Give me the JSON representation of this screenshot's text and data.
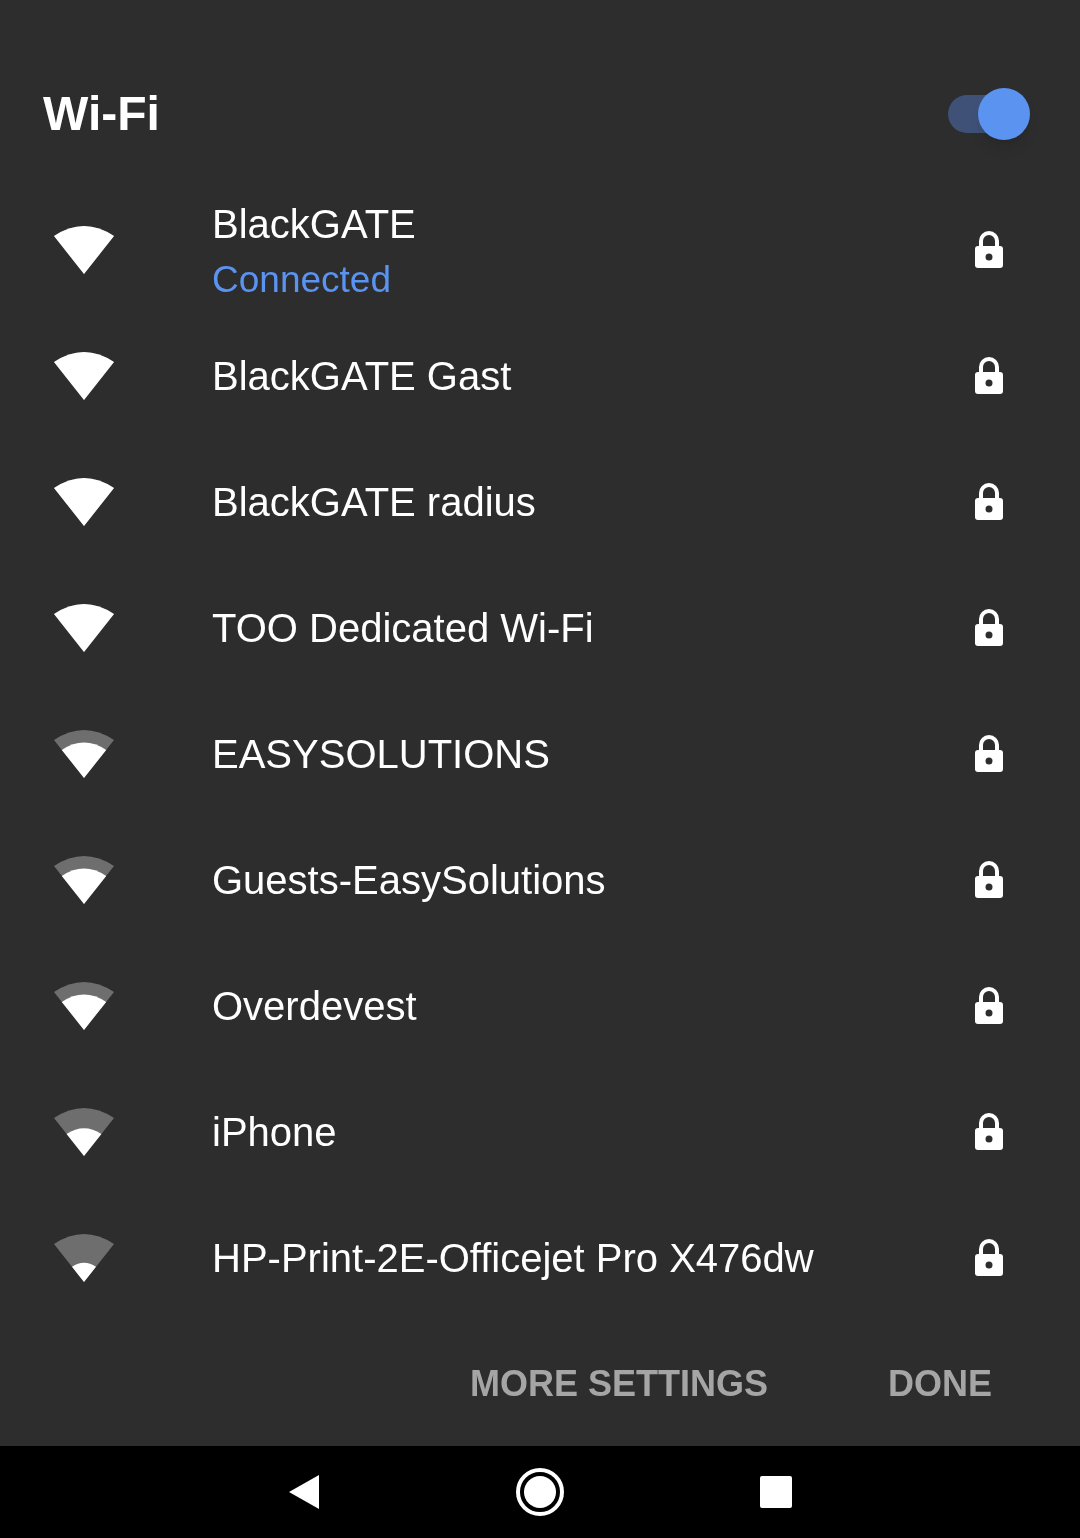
{
  "header": {
    "title": "Wi-Fi",
    "on": true
  },
  "networks": [
    {
      "name": "BlackGATE",
      "status": "Connected",
      "kind": "full",
      "locked": true
    },
    {
      "name": "BlackGATE Gast",
      "kind": "full",
      "locked": true
    },
    {
      "name": "BlackGATE radius",
      "kind": "full",
      "locked": true
    },
    {
      "name": "TOO Dedicated Wi-Fi",
      "kind": "full",
      "locked": true
    },
    {
      "name": "EASYSOLUTIONS",
      "kind": "strong",
      "locked": true
    },
    {
      "name": "Guests-EasySolutions",
      "kind": "strong",
      "locked": true
    },
    {
      "name": "Overdevest",
      "kind": "strong",
      "locked": true
    },
    {
      "name": "iPhone",
      "kind": "medium",
      "locked": true
    },
    {
      "name": "HP-Print-2E-Officejet Pro X476dw",
      "kind": "weak",
      "locked": true
    }
  ],
  "buttons": [
    "MORE SETTINGS",
    "DONE"
  ]
}
